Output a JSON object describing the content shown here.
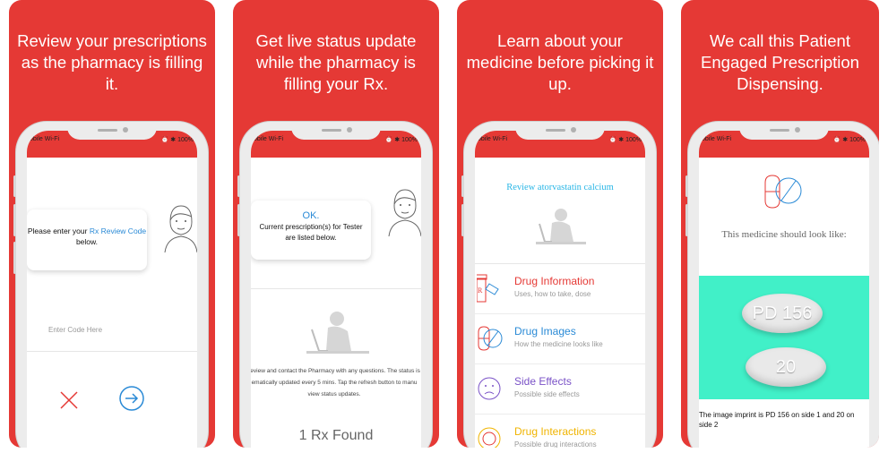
{
  "colors": {
    "brand": "#e53935",
    "link": "#2a8ad6",
    "teal": "#41f0c8",
    "drug_info": "#e53935",
    "drug_images": "#2a8ad6",
    "side_effects": "#7a52c7",
    "interactions": "#f0b400"
  },
  "panels": [
    {
      "caption": "Review your prescriptions as the pharmacy is filling it.",
      "status_left": "obile Wi-Fi",
      "status_right": "100%",
      "bubble_prefix": "Please enter your ",
      "bubble_link": "Rx Review Code",
      "bubble_suffix": " below.",
      "input_placeholder": "Enter Code Here",
      "cancel_icon": "close-x-icon",
      "submit_icon": "arrow-right-circle-icon"
    },
    {
      "caption": "Get live status update while the pharmacy is filling your Rx.",
      "status_left": "obile Wi-Fi",
      "status_right": "100%",
      "bubble_title": "OK.",
      "bubble_text": "Current prescription(s) for Tester are listed below.",
      "info_text": "review and contact the Pharmacy with any questions. The status is ematically updated every 5 mins. Tap the refresh button to manu view status updates.",
      "rx_found": "1 Rx Found"
    },
    {
      "caption": "Learn about your medicine before picking it up.",
      "status_left": "obile Wi-Fi",
      "status_right": "100%",
      "review_title": "Review atorvastatin calcium",
      "menu": [
        {
          "title": "Drug Information",
          "subtitle": "Uses, how to take, dose",
          "icon": "pill-bottle-icon"
        },
        {
          "title": "Drug Images",
          "subtitle": "How the medicine looks like",
          "icon": "capsule-icon"
        },
        {
          "title": "Side Effects",
          "subtitle": "Possible side effects",
          "icon": "sad-face-icon"
        },
        {
          "title": "Drug Interactions",
          "subtitle": "Possible drug interactions",
          "icon": "interaction-icon"
        }
      ]
    },
    {
      "caption": "We call this Patient Engaged Prescription Dispensing.",
      "status_left": "obile Wi-Fi",
      "status_right": "100%",
      "look_like": "This medicine should look like:",
      "pill_top": "PD 156",
      "pill_bottom": "20",
      "imprint": "The image imprint is PD 156 on side 1 and 20 on side 2"
    }
  ]
}
